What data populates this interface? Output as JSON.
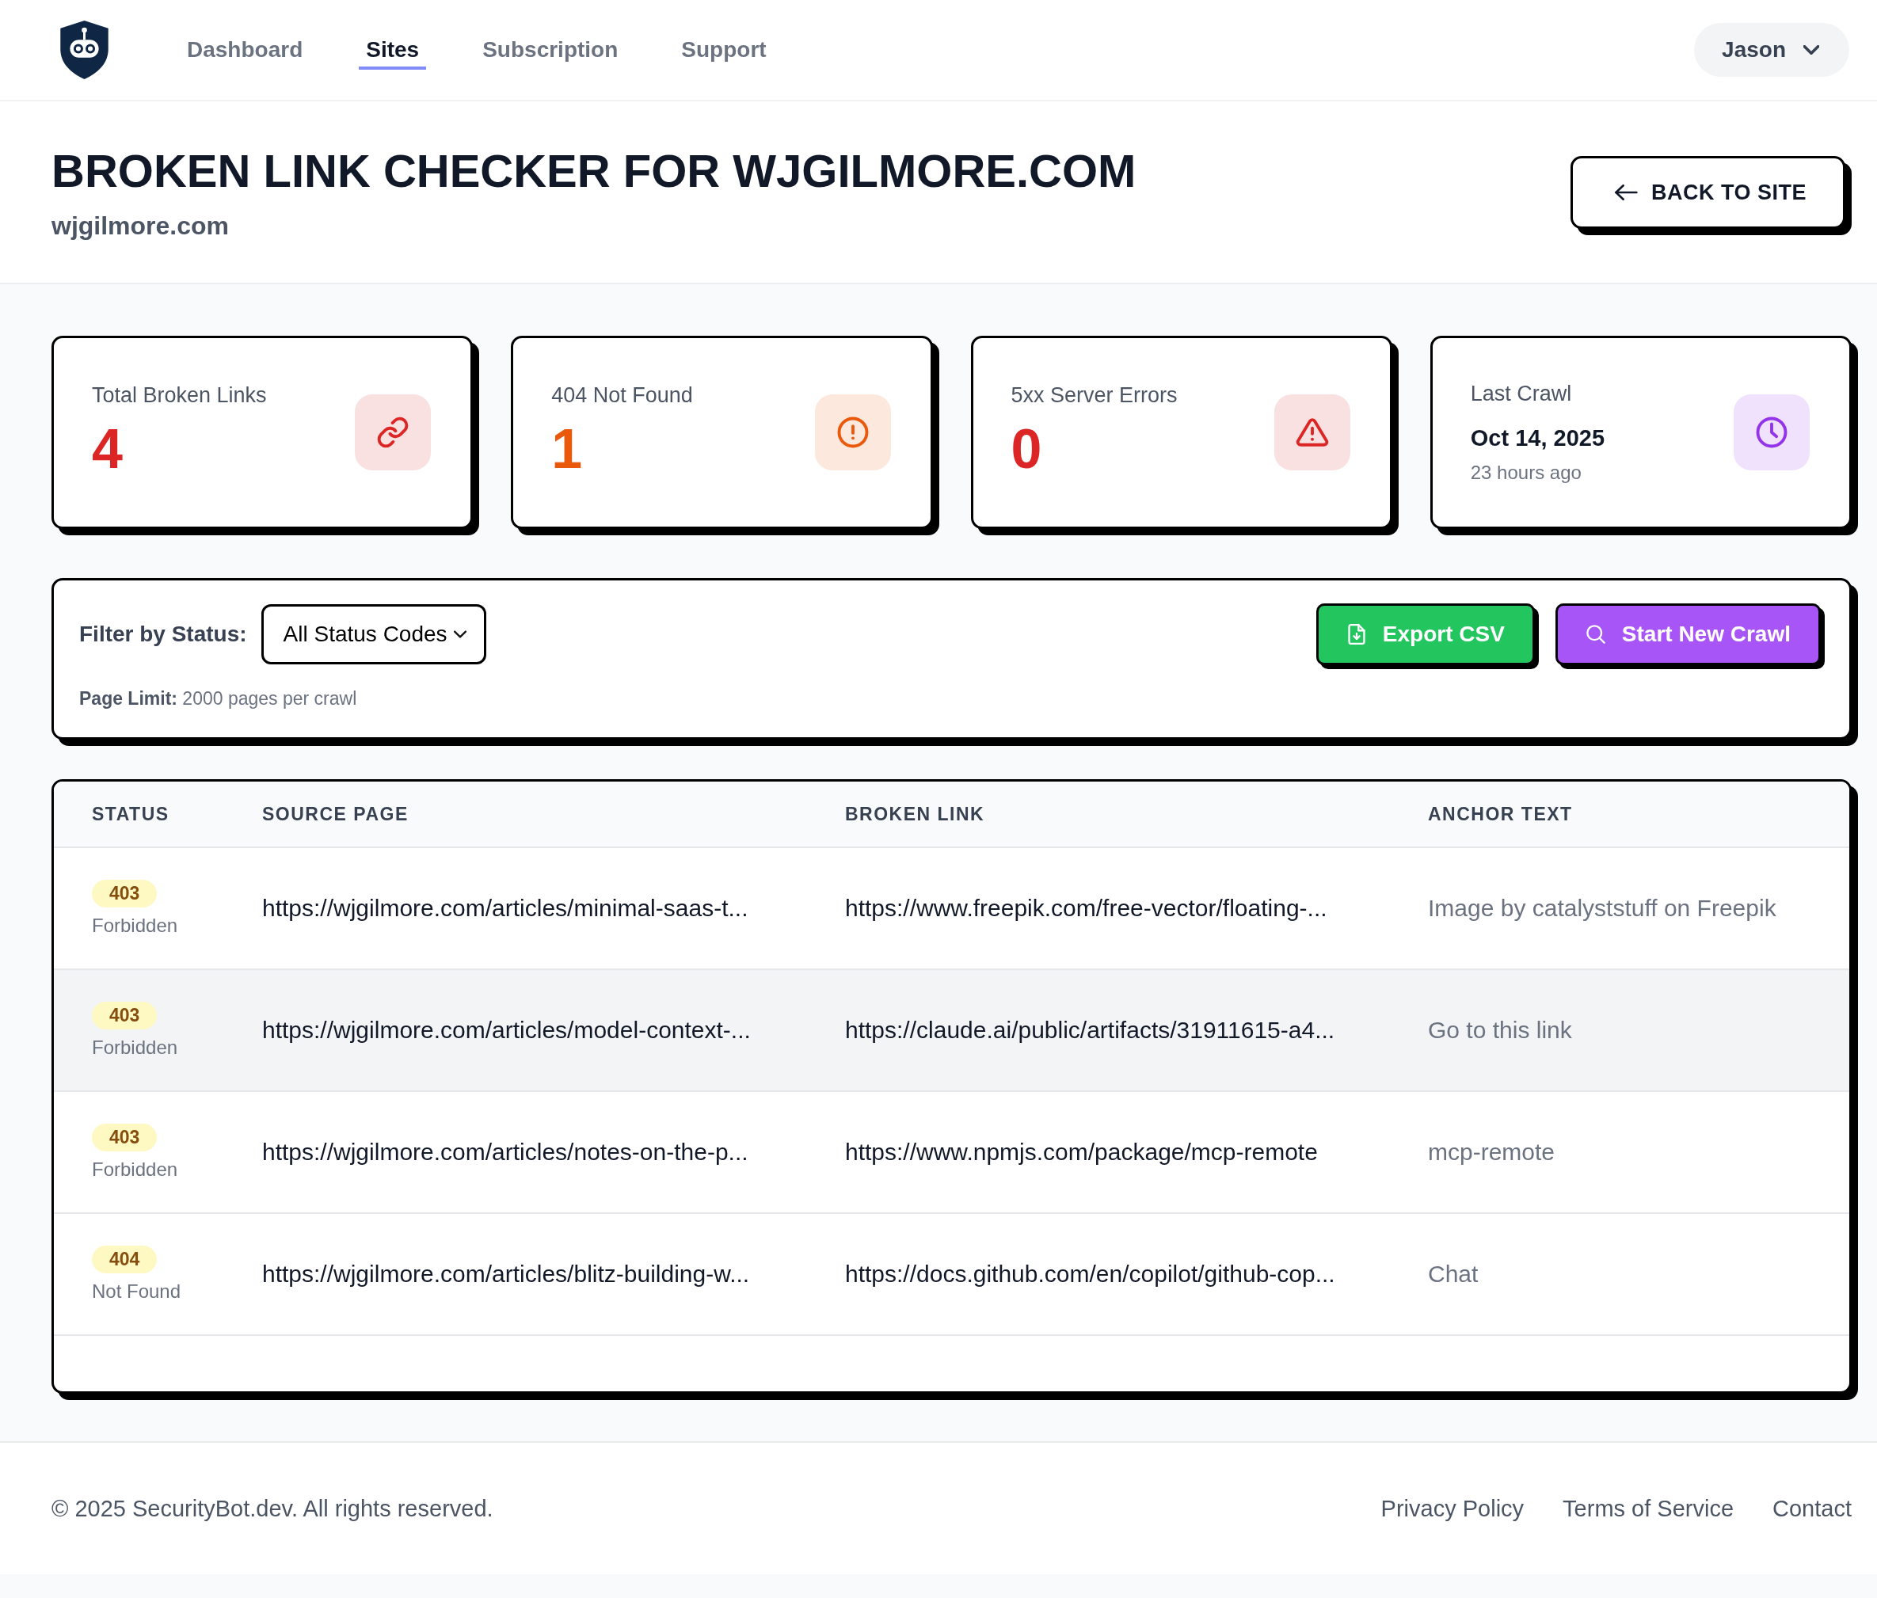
{
  "nav": {
    "items": [
      {
        "label": "Dashboard",
        "selected": false
      },
      {
        "label": "Sites",
        "selected": true
      },
      {
        "label": "Subscription",
        "selected": false
      },
      {
        "label": "Support",
        "selected": false
      }
    ],
    "user_menu": {
      "label": "Jason"
    }
  },
  "header": {
    "title": "BROKEN LINK CHECKER FOR WJGILMORE.COM",
    "subtitle": "wjgilmore.com",
    "back_button": "BACK TO SITE"
  },
  "stats": [
    {
      "kind": "count",
      "label": "Total Broken Links",
      "value": "4",
      "color": "#dc2626"
    },
    {
      "kind": "count",
      "label": "404 Not Found",
      "value": "1",
      "color": "#ea580c"
    },
    {
      "kind": "count",
      "label": "5xx Server Errors",
      "value": "0",
      "color": "#dc2626"
    },
    {
      "kind": "date",
      "label": "Last Crawl",
      "value": "Oct 14, 2025",
      "note": "23 hours ago",
      "color": "#9333ea"
    }
  ],
  "filter": {
    "label": "Filter by Status:",
    "select_value": "All Status Codes",
    "page_limit": "**Page Limit:** 2000 pages per crawl",
    "buttons": [
      {
        "label": "Export CSV",
        "color": "#22c55e"
      },
      {
        "label": "Start New Crawl",
        "color": "#a855f7"
      }
    ]
  },
  "table": {
    "columns": [
      "STATUS",
      "SOURCE PAGE",
      "BROKEN LINK",
      "ANCHOR TEXT"
    ],
    "rows": [
      {
        "status": "403",
        "status_text": "Forbidden",
        "source_page": "https://wjgilmore.com/articles/minimal-saas-t...",
        "broken_link": "https://www.freepik.com/free-vector/floating-...",
        "anchor_text": "Image by catalyststuff on Freepik",
        "hovered": false
      },
      {
        "status": "403",
        "status_text": "Forbidden",
        "source_page": "https://wjgilmore.com/articles/model-context-...",
        "broken_link": "https://claude.ai/public/artifacts/31911615-a4...",
        "anchor_text": "Go to this link",
        "hovered": true
      },
      {
        "status": "403",
        "status_text": "Forbidden",
        "source_page": "https://wjgilmore.com/articles/notes-on-the-p...",
        "broken_link": "https://www.npmjs.com/package/mcp-remote",
        "anchor_text": "mcp-remote",
        "hovered": false
      },
      {
        "status": "404",
        "status_text": "Not Found",
        "source_page": "https://wjgilmore.com/articles/blitz-building-w...",
        "broken_link": "https://docs.github.com/en/copilot/github-cop...",
        "anchor_text": "Chat",
        "hovered": false
      }
    ]
  },
  "footer": {
    "copyright": "© 2025 SecurityBot.dev. All rights reserved.",
    "links": [
      "Privacy Policy",
      "Terms of Service",
      "Contact"
    ]
  }
}
